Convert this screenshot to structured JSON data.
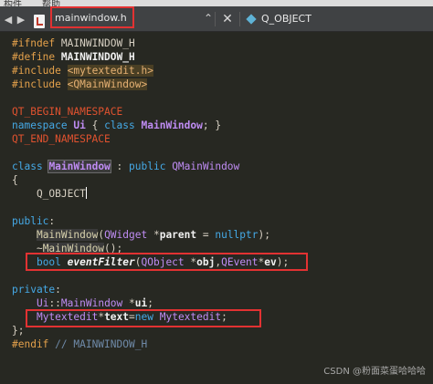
{
  "menubar": {
    "items": [
      "构件",
      "帮助"
    ]
  },
  "tabbar": {
    "file_name": "mainwindow.h",
    "file_icon": "header-file-icon",
    "class_label": "Q_OBJECT",
    "close_glyph": "✕"
  },
  "code": {
    "l1": [
      "#ifndef",
      " MAINWINDOW_H"
    ],
    "l2": [
      "#define",
      " MAINWINDOW_H"
    ],
    "l3": [
      "#include",
      " ",
      "<mytextedit.h>"
    ],
    "l4": [
      "#include",
      " ",
      "<QMainWindow>"
    ],
    "l5": [
      "QT_BEGIN_NAMESPACE"
    ],
    "l6": [
      "namespace",
      " ",
      "Ui",
      " { ",
      "class",
      " ",
      "MainWindow",
      "; }"
    ],
    "l7": [
      "QT_END_NAMESPACE"
    ],
    "l8": [
      "class",
      " ",
      "MainWindow",
      " : ",
      "public",
      " ",
      "QMainWindow"
    ],
    "l9": [
      "{"
    ],
    "l10": [
      "    Q_OBJECT"
    ],
    "l11": [
      "public",
      ":"
    ],
    "l12": [
      "    ",
      "MainWindow",
      "(",
      "QWidget",
      " *",
      "parent",
      " = ",
      "nullptr",
      ");"
    ],
    "l13": [
      "    ~",
      "MainWindow",
      "();"
    ],
    "l14": [
      "    ",
      "bool",
      " ",
      "eventFilter",
      "(",
      "QObject",
      " *",
      "obj",
      ",",
      "QEvent",
      "*",
      "ev",
      ");"
    ],
    "l15": [
      "private",
      ":"
    ],
    "l16": [
      "    ",
      "Ui",
      "::",
      "MainWindow",
      " *",
      "ui",
      ";"
    ],
    "l17": [
      "    ",
      "Mytextedit",
      "*",
      "text",
      "=",
      "new",
      " ",
      "Mytextedit",
      ";"
    ],
    "l18": [
      "};"
    ],
    "l19": [
      "#endif",
      " // MAINWINDOW_H"
    ]
  },
  "watermark": "CSDN @粉面菜蛋哈哈哈",
  "colors": {
    "background": "#272822",
    "highlight_box": "#e23232",
    "keyword": "#45a9e6",
    "type": "#bf8cf3",
    "macro": "#e0522f"
  }
}
